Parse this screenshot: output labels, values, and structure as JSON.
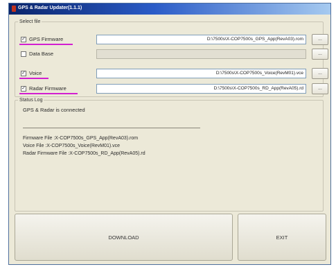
{
  "window": {
    "title": "GPS & Radar Updater(1.1.1)"
  },
  "file_group": {
    "legend": "Select file",
    "rows": [
      {
        "label": "GPS Firmware",
        "checked": true,
        "path": "D:\\7500s\\X-COP7500s_GPS_App(RevA03).rom",
        "enabled": true,
        "browse": "..."
      },
      {
        "label": "Data Base",
        "checked": false,
        "path": "",
        "enabled": false,
        "browse": "..."
      },
      {
        "label": "Voice",
        "checked": true,
        "path": "D:\\7500s\\X-COP7500s_Voice(RevM01).vce",
        "enabled": true,
        "browse": "..."
      },
      {
        "label": "Radar Firmware",
        "checked": true,
        "path": "D:\\7500s\\X-COP7500s_RD_App(RevA05).rd",
        "enabled": true,
        "browse": "..."
      }
    ]
  },
  "status": {
    "legend": "Status Log",
    "message": "GPS & Radar is connected",
    "lines": [
      "Firmware File :X-COP7500s_GPS_App(RevA03).rom",
      "Voice File     :X-COP7500s_Voice(RevM01).vce",
      "Radar Firmware File :X-COP7500s_RD_App(RevA05).rd"
    ]
  },
  "buttons": {
    "download": "DOWNLOAD",
    "exit": "EXIT"
  },
  "colors": {
    "underline_highlight": "#d21fd0",
    "titlebar": "#0a246a"
  }
}
